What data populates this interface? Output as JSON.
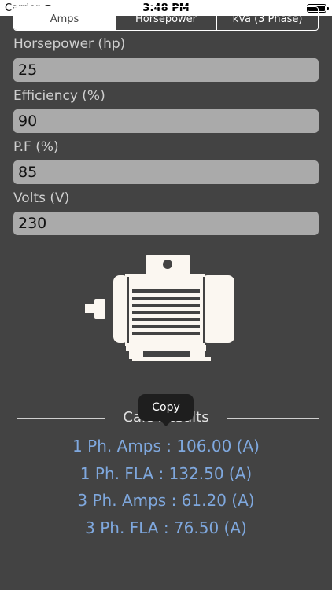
{
  "status_bar": {
    "carrier": "Carrier",
    "time": "3:48 PM"
  },
  "tabs": [
    {
      "label": "Amps",
      "active": true
    },
    {
      "label": "Horsepower",
      "active": false
    },
    {
      "label": "kVa (3 Phase)",
      "active": false
    }
  ],
  "fields": {
    "horsepower": {
      "label": "Horsepower (hp)",
      "value": "25"
    },
    "efficiency": {
      "label": "Efficiency (%)",
      "value": "90"
    },
    "pf": {
      "label": "P.F (%)",
      "value": "85"
    },
    "volts": {
      "label": "Volts (V)",
      "value": "230"
    }
  },
  "results": {
    "title": "Calc Results",
    "lines": [
      "1 Ph. Amps : 106.00 (A)",
      "1 Ph. FLA : 132.50 (A)",
      "3 Ph. Amps : 61.20 (A)",
      "3 Ph. FLA : 76.50 (A)"
    ]
  },
  "tooltip": {
    "label": "Copy"
  },
  "colors": {
    "background": "#434343",
    "input_fill": "#aaaaaa",
    "result_text": "#7fa8de",
    "motor": "#fbf7f1"
  },
  "icons": {
    "motor": "electric-motor-icon",
    "wifi": "wifi-icon",
    "battery": "battery-icon"
  }
}
